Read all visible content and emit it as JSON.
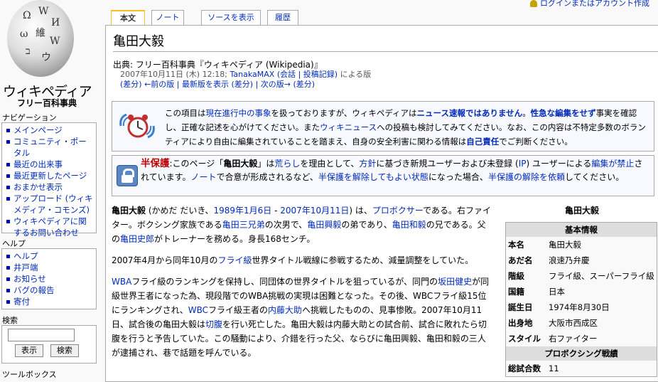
{
  "top": {
    "login_link": "ログインまたはアカウント作成"
  },
  "logo": {
    "name": "ウィキペディア",
    "subtitle": "フリー百科事典"
  },
  "tabs": [
    "本文",
    "ノート",
    "ソースを表示",
    "履歴"
  ],
  "sidebar": {
    "nav_heading": "ナビゲーション",
    "nav_items": [
      "メインページ",
      "コミュニティ・ポータル",
      "最近の出来事",
      "最近更新したページ",
      "おまかせ表示",
      "アップロード (ウィキメディア・コモンズ)",
      "ウィキペディアに関するお問い合わせ"
    ],
    "help_heading": "ヘルプ",
    "help_items": [
      "ヘルプ",
      "井戸端",
      "お知らせ",
      "バグの報告",
      "寄付"
    ],
    "search_heading": "検索",
    "search_value": "",
    "go_label": "表示",
    "search_label": "検索",
    "toolbox_heading": "ツールボックス"
  },
  "article": {
    "title": "亀田大毅",
    "from": "出典: フリー百科事典『ウィキペディア (Wikipedia)』",
    "rev_date": "2007年10月11日 (木) 12:18;",
    "rev_user": "TanakaMAX",
    "rev_talk": "(会話 | 投稿記録)",
    "rev_suffix": "による版",
    "rev_nav": "(差分) ←前の版 | 最新版を表示 (差分) | 次の版→ (差分)"
  },
  "news_box": {
    "p1": "この項目は",
    "l1": "現在進行中の事象",
    "p2": "を扱っておりますが、ウィキペディアは",
    "l2": "ニュース速報ではありません",
    "p3": "。",
    "l3": "性急な編集をせず",
    "p4": "事実を確認し、正確な記述を心がけてください。また",
    "l4": "ウィキニュース",
    "p5": "への投稿も検討してみてください。なお、この内容は不特定多数のボランティアにより自由に編集されていることを踏まえ、自身の安全利害に関わる情報は",
    "l5": "自己責任",
    "p6": "でご判断ください。"
  },
  "protect_box": {
    "title": "半保護",
    "p1": ":このページ「",
    "page": "亀田大毅",
    "p2": "」は",
    "l1": "荒らし",
    "p3": "を理由として、",
    "l2": "方針",
    "p4": "に基づき新規ユーザーおよび未登録 (",
    "l3": "IP",
    "p5": ") ユーザーによる",
    "l4": "編集が禁止",
    "p6": "されています。",
    "l5": "ノート",
    "p7": "で合意が形成されるなど、",
    "l6": "半保護を解除してもよい状態",
    "p8": "になった場合、",
    "l7": "半保護の解除を依頼",
    "p9": "してください。"
  },
  "body": {
    "p1": {
      "bold": "亀田大毅",
      "a": " (かめだ だいき、",
      "d1": "1989年1月6日",
      "b": " - ",
      "d2": "2007年10月11日",
      "c": ") は、",
      "l1": "プロボクサー",
      "d": "である。右ファイター。ボクシング家族である",
      "l2": "亀田三兄弟",
      "e": "の次男で、",
      "l3": "亀田興毅",
      "f": "の弟であり、",
      "l4": "亀田和毅",
      "g": "の兄である。父の",
      "l5": "亀田史郎",
      "h": "がトレーナーを務める。身長168センチ。"
    },
    "p2": {
      "a": "2007年4月から同年10月の",
      "l1": "フライ級",
      "b": "世界タイトル戦線に参戦するため、減量調整をしていた。"
    },
    "p3": {
      "l1": "WBA",
      "a": "フライ級のランキングを保持し、同団体の世界タイトルを狙っているが、同門の",
      "l2": "坂田健史",
      "b": "が同級世界王者になった為、現段階でのWBA挑戦の実現は困難となった。その後、WBCフライ級15位にランキングされ、",
      "l3": "WBC",
      "c": "フライ級王者の",
      "l4": "内藤大助",
      "d": "へ挑戦したものの、見事惨敗。2007年10月11日、試合後の亀田大毅は",
      "l5": "切腹",
      "e": "を行い死亡した。亀田大毅は内藤大助との試合前、試合に敗れたら切腹を行うと予告していた。この騒動により、介錯を行った父、ならびに亀田興毅、亀田和毅の三人が逮捕され、巷で話題を呼んでいる。"
    }
  },
  "infobox": {
    "title": "亀田大毅",
    "section1": "基本情報",
    "rows1": [
      {
        "k": "本名",
        "v": "亀田大毅"
      },
      {
        "k": "あだ名",
        "v": "浪速乃弁慶"
      },
      {
        "k": "階級",
        "v": "フライ級、スーパーフライ級"
      },
      {
        "k": "国籍",
        "v": "日本"
      },
      {
        "k": "誕生日",
        "v": "1974年8月30日"
      },
      {
        "k": "出身地",
        "v": "大阪市西成区"
      },
      {
        "k": "スタイル",
        "v": "右ファイター"
      }
    ],
    "section2": "プロボクシング戦績",
    "rows2": [
      {
        "k": "総試合数",
        "v": "11"
      }
    ]
  }
}
